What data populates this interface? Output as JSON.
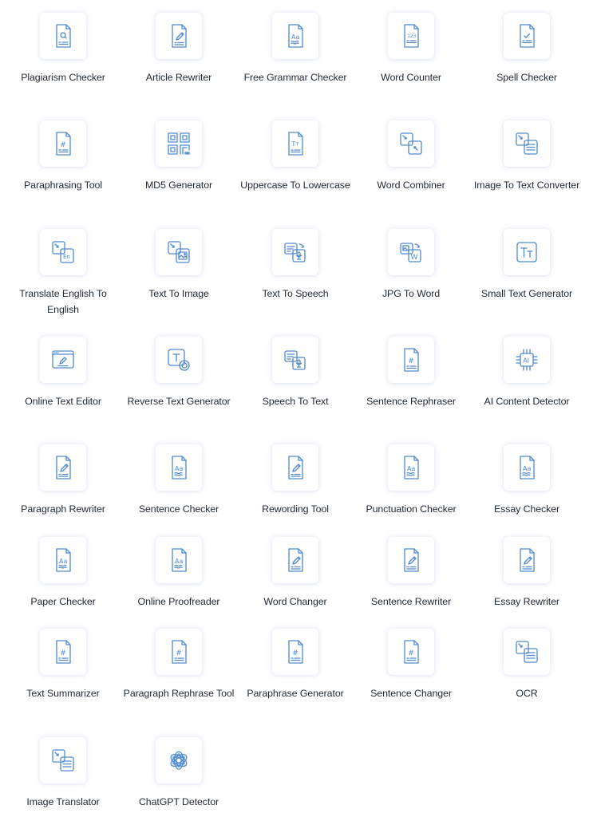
{
  "tools": [
    {
      "label": "Plagiarism Checker",
      "icon": "doc-search"
    },
    {
      "label": "Article Rewriter",
      "icon": "doc-pencil"
    },
    {
      "label": "Free Grammar Checker",
      "icon": "doc-aa"
    },
    {
      "label": "Word Counter",
      "icon": "doc-123"
    },
    {
      "label": "Spell Checker",
      "icon": "doc-check"
    },
    {
      "label": "Paraphrasing Tool",
      "icon": "doc-hash"
    },
    {
      "label": "MD5 Generator",
      "icon": "qr-code"
    },
    {
      "label": "Uppercase To Lowercase",
      "icon": "doc-tt"
    },
    {
      "label": "Word Combiner",
      "icon": "combine-squares"
    },
    {
      "label": "Image To Text Converter",
      "icon": "convert-text"
    },
    {
      "label": "Translate English To English",
      "icon": "convert-en"
    },
    {
      "label": "Text To Image",
      "icon": "convert-image"
    },
    {
      "label": "Text To Speech",
      "icon": "text-speech"
    },
    {
      "label": "JPG To Word",
      "icon": "image-word"
    },
    {
      "label": "Small Text Generator",
      "icon": "box-tt"
    },
    {
      "label": "Online Text Editor",
      "icon": "browser-pencil"
    },
    {
      "label": "Reverse Text Generator",
      "icon": "box-t-reverse"
    },
    {
      "label": "Speech To Text",
      "icon": "speech-text"
    },
    {
      "label": "Sentence Rephraser",
      "icon": "doc-hash"
    },
    {
      "label": "AI Content Detector",
      "icon": "ai-chip"
    },
    {
      "label": "Paragraph Rewriter",
      "icon": "doc-pencil"
    },
    {
      "label": "Sentence Checker",
      "icon": "doc-aa"
    },
    {
      "label": "Rewording Tool",
      "icon": "doc-pencil"
    },
    {
      "label": "Punctuation Checker",
      "icon": "doc-aa"
    },
    {
      "label": "Essay Checker",
      "icon": "doc-aa"
    },
    {
      "label": "Paper Checker",
      "icon": "doc-aa"
    },
    {
      "label": "Online Proofreader",
      "icon": "doc-aa"
    },
    {
      "label": "Word Changer",
      "icon": "doc-pencil"
    },
    {
      "label": "Sentence Rewriter",
      "icon": "doc-pencil"
    },
    {
      "label": "Essay Rewriter",
      "icon": "doc-pencil"
    },
    {
      "label": "Text Summarizer",
      "icon": "doc-hash"
    },
    {
      "label": "Paragraph Rephrase Tool",
      "icon": "doc-hash"
    },
    {
      "label": "Paraphrase Generator",
      "icon": "doc-hash"
    },
    {
      "label": "Sentence Changer",
      "icon": "doc-hash"
    },
    {
      "label": "OCR",
      "icon": "convert-text"
    },
    {
      "label": "Image Translator",
      "icon": "convert-text"
    },
    {
      "label": "ChatGPT Detector",
      "icon": "openai-knot"
    }
  ],
  "theme": {
    "icon_color": "#4f8ad0",
    "label_color": "#1f2933"
  }
}
